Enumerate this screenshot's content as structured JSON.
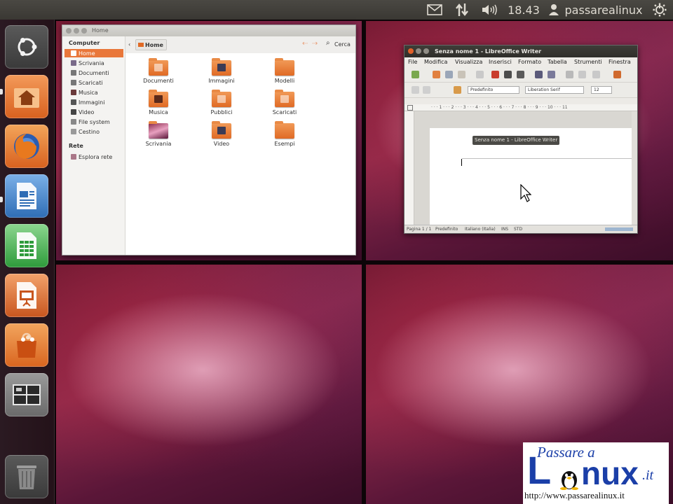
{
  "top_panel": {
    "clock": "18.43",
    "username": "passarealinux",
    "indicators": [
      "mail-icon",
      "network-icon",
      "volume-icon",
      "user-icon",
      "power-icon"
    ]
  },
  "launcher": {
    "items": [
      {
        "name": "dash-home",
        "color": "#4d4d4d"
      },
      {
        "name": "files",
        "color": "#e07a3c"
      },
      {
        "name": "firefox",
        "color": "#e8792c"
      },
      {
        "name": "libreoffice-writer",
        "color": "#3d7fc4"
      },
      {
        "name": "libreoffice-calc",
        "color": "#3ea548"
      },
      {
        "name": "libreoffice-impress",
        "color": "#d36b2f"
      },
      {
        "name": "software-center",
        "color": "#e07a3c"
      },
      {
        "name": "workspace-switcher",
        "color": "#707070"
      },
      {
        "name": "trash",
        "color": "#555555"
      }
    ]
  },
  "nautilus": {
    "title": "Home",
    "sidebar": {
      "computer_heading": "Computer",
      "items": [
        {
          "label": "Home",
          "icon": "home-icon",
          "active": true
        },
        {
          "label": "Scrivania",
          "icon": "desktop-icon"
        },
        {
          "label": "Documenti",
          "icon": "documents-icon"
        },
        {
          "label": "Scaricati",
          "icon": "downloads-icon"
        },
        {
          "label": "Musica",
          "icon": "music-icon"
        },
        {
          "label": "Immagini",
          "icon": "pictures-icon"
        },
        {
          "label": "Video",
          "icon": "video-icon"
        },
        {
          "label": "File system",
          "icon": "filesystem-icon"
        },
        {
          "label": "Cestino",
          "icon": "trash-icon"
        }
      ],
      "network_heading": "Rete",
      "network_items": [
        {
          "label": "Esplora rete",
          "icon": "network-icon"
        }
      ]
    },
    "toolbar": {
      "location": "Home",
      "search_label": "Cerca"
    },
    "folders": [
      {
        "label": "Documenti"
      },
      {
        "label": "Immagini"
      },
      {
        "label": "Modelli"
      },
      {
        "label": "Musica"
      },
      {
        "label": "Pubblici"
      },
      {
        "label": "Scaricati"
      },
      {
        "label": "Scrivania"
      },
      {
        "label": "Video"
      },
      {
        "label": "Esempi"
      }
    ]
  },
  "writer": {
    "title": "Senza nome 1 - LibreOffice Writer",
    "menu": [
      "File",
      "Modifica",
      "Visualizza",
      "Inserisci",
      "Formato",
      "Tabella",
      "Strumenti",
      "Finestra"
    ],
    "paragraph_style": "Predefinito",
    "font_name": "Liberation Serif",
    "font_size": "12",
    "ruler_text": "· · · 1 · · · 2 · · · 3 · · · 4 · · · 5 · · · 6 · · · 7 · · · 8 · · · 9 · · · 10 · · · 11",
    "tooltip": "Senza nome 1 - LibreOffice Writer",
    "status": [
      "Pagina 1 / 1",
      "Predefinito",
      "Italiano (Italia)",
      "INS",
      "STD"
    ]
  },
  "logo": {
    "line1": "Passare a",
    "line2_a": "L",
    "line2_b": "nux",
    "tld": ".it",
    "url": "http://www.passarealinux.it"
  }
}
